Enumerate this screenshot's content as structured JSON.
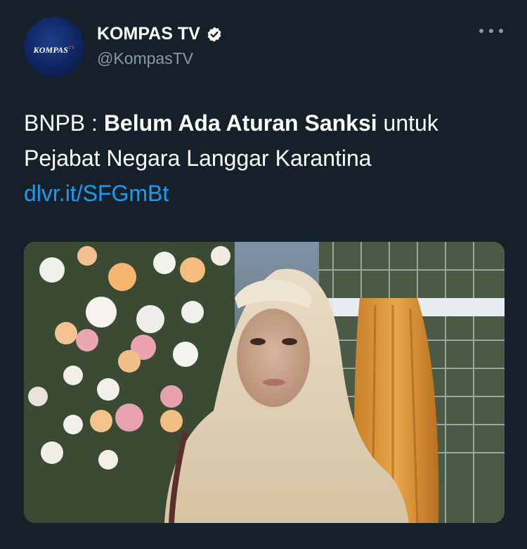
{
  "tweet": {
    "author": {
      "avatar_text": "KOMPAS",
      "avatar_sup": "TV",
      "display_name": "KOMPAS TV",
      "handle": "@KompasTV",
      "verified": true
    },
    "text": {
      "prefix": "BNPB : ",
      "bold": "Belum Ada Aturan Sanksi",
      "rest": " untuk Pejabat Negara Langgar Karantina ",
      "link": "dlvr.it/SFGmBt"
    },
    "colors": {
      "background": "#15202b",
      "link": "#1d9bf0",
      "secondary_text": "#8b98a5",
      "verified_badge": "#ffffff"
    },
    "icons": [
      "verified-icon",
      "more-icon"
    ]
  }
}
